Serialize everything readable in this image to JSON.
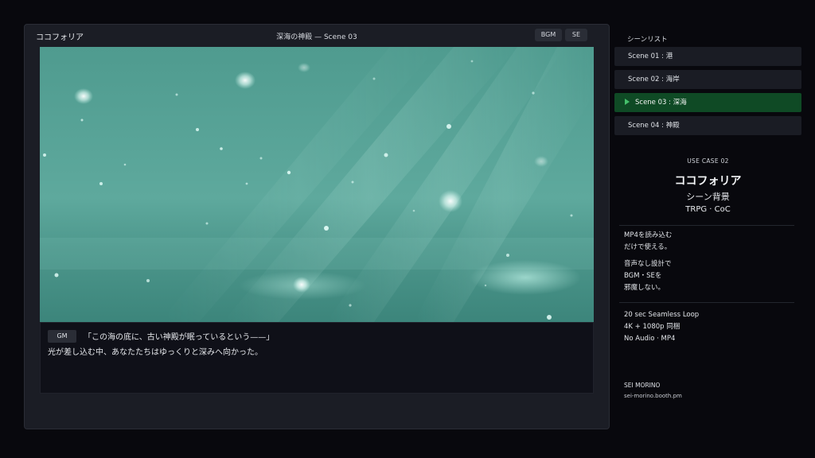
{
  "window": {
    "app_title": "ココフォリア",
    "scene_title": "深海の神殿 — Scene 03",
    "buttons": {
      "bgm": "BGM",
      "se": "SE"
    }
  },
  "scene_image": {
    "description_icon": "underwater-scene-image",
    "colors": {
      "water": "#5fa89c",
      "deep": "#2f7a72",
      "light": "#b9ede2"
    }
  },
  "dialog": {
    "speaker": "GM",
    "line1": "「この海の底に、古い神殿が眠っているという——」",
    "line2": "光が差し込む中、あなたたちはゆっくりと深みへ向かった。"
  },
  "sidebar": {
    "title": "シーンリスト",
    "scenes": [
      {
        "label": "Scene 01 : 港",
        "active": false
      },
      {
        "label": "Scene 02 : 海岸",
        "active": false
      },
      {
        "label": "Scene 03 : 深海",
        "active": true
      },
      {
        "label": "Scene 04 : 神殿",
        "active": false
      }
    ],
    "active_color": "#0f4a25"
  },
  "info": {
    "use_case": "USE CASE 02",
    "brand": "ココフォリア",
    "subtitle": "シーン背景",
    "tags": "TRPG · CoC",
    "feature1": "MP4を読み込む\nだけで使える。",
    "feature2": "音声なし設計で\nBGM・SEを\n邪魔しない。",
    "feature3": "20 sec Seamless Loop\n4K + 1080p 同梱\nNo Audio · MP4",
    "credit_name": "SEI MORINO",
    "credit_url": "sei-morino.booth.pm"
  }
}
